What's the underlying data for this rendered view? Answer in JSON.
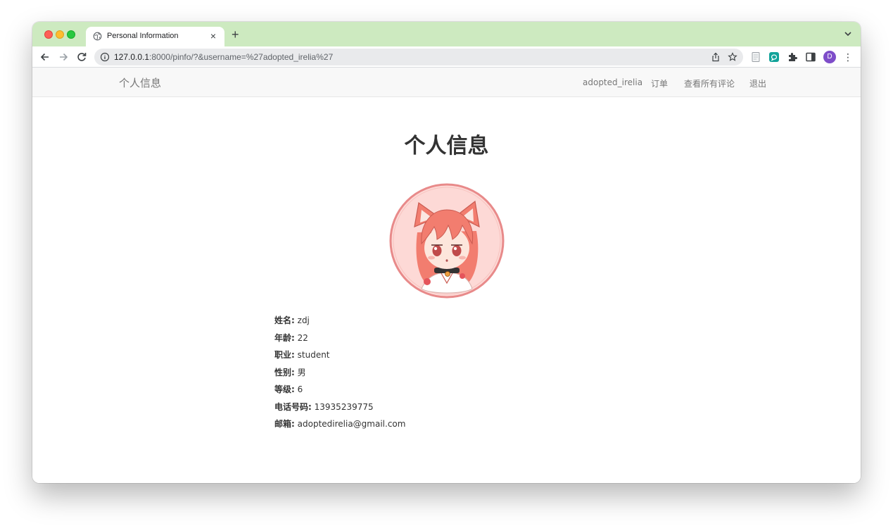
{
  "browser": {
    "tab_title": "Personal Information",
    "tab_close": "×",
    "new_tab": "+",
    "url_host": "127.0.0.1",
    "url_rest": ":8000/pinfo/?&username=%27adopted_irelia%27",
    "avatar_letter": "D",
    "menu_glyph": "⋮"
  },
  "navbar": {
    "brand": "个人信息",
    "links": [
      "adopted_irelia",
      "订单",
      "查看所有评论",
      "退出"
    ]
  },
  "main": {
    "heading": "个人信息",
    "avatar_colors": {
      "ring": "#e88a8a",
      "bg": "#fdd9d6",
      "hair": "#f27d6f"
    },
    "fields": [
      {
        "label": "姓名:",
        "value": "zdj"
      },
      {
        "label": "年龄:",
        "value": "22"
      },
      {
        "label": "职业:",
        "value": "student"
      },
      {
        "label": "性别:",
        "value": "男"
      },
      {
        "label": "等级:",
        "value": "6"
      },
      {
        "label": "电话号码:",
        "value": "13935239775"
      },
      {
        "label": "邮箱:",
        "value": "adoptedirelia@gmail.com"
      }
    ]
  }
}
